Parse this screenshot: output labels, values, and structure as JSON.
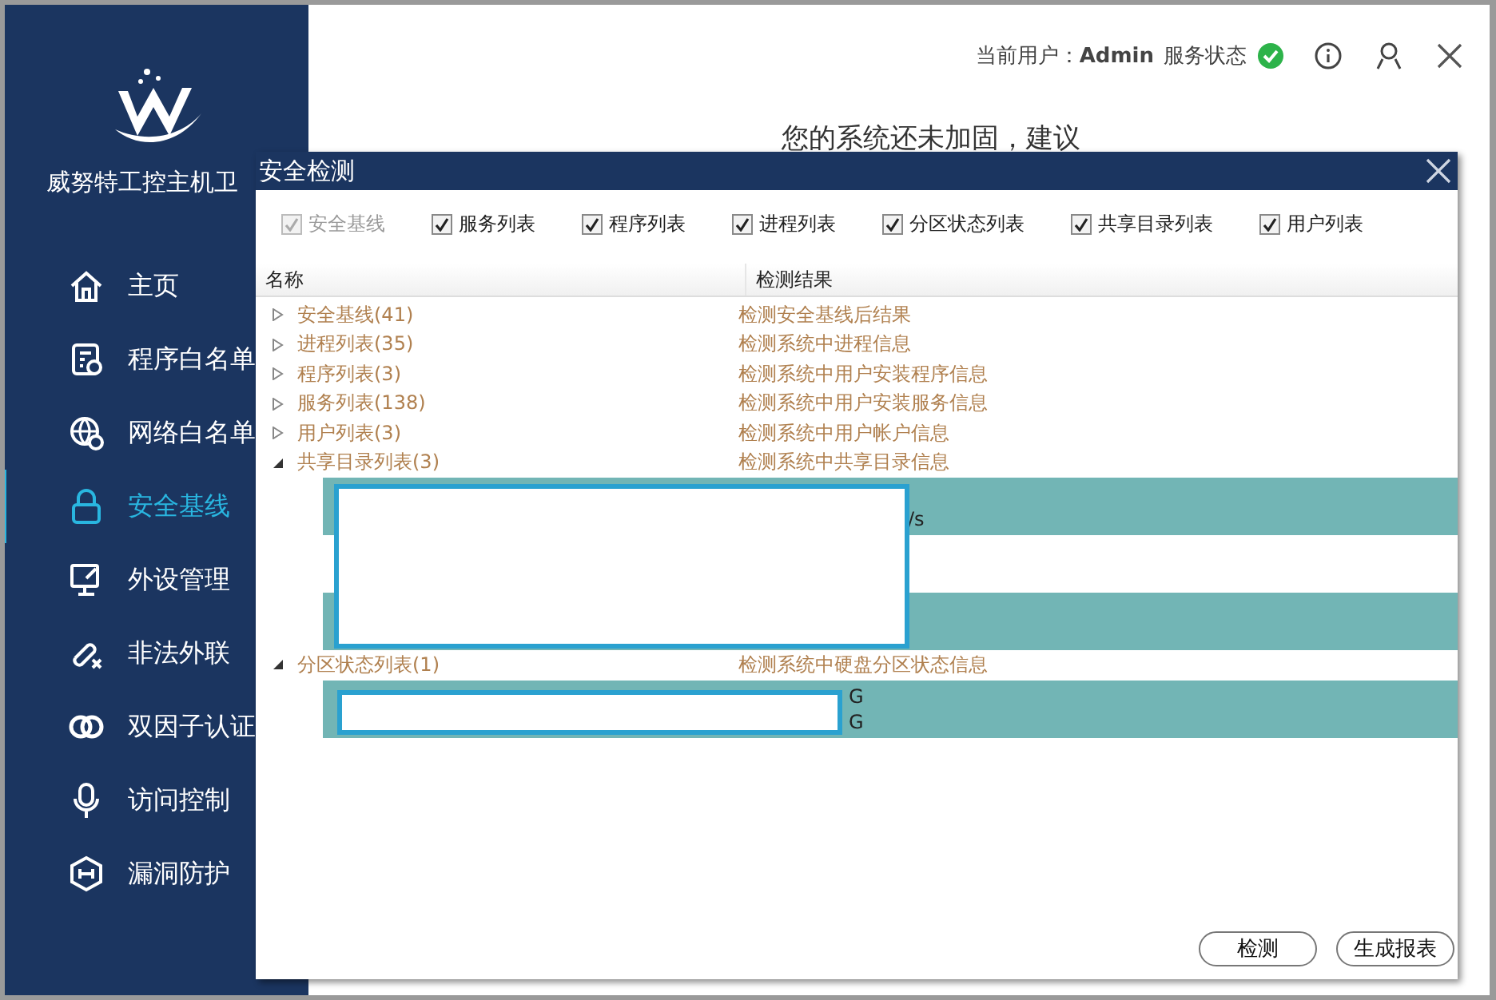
{
  "app": {
    "title": "威努特工控主机卫"
  },
  "sidebar": {
    "items": [
      {
        "label": "主页",
        "selected": false
      },
      {
        "label": "程序白名单",
        "selected": false
      },
      {
        "label": "网络白名单",
        "selected": false
      },
      {
        "label": "安全基线",
        "selected": true
      },
      {
        "label": "外设管理",
        "selected": false
      },
      {
        "label": "非法外联",
        "selected": false
      },
      {
        "label": "双因子认证",
        "selected": false
      },
      {
        "label": "访问控制",
        "selected": false
      },
      {
        "label": "漏洞防护",
        "selected": false
      }
    ]
  },
  "header": {
    "user_label": "当前用户：",
    "user": "Admin",
    "service_label": "服务状态",
    "service_ok": true
  },
  "main": {
    "notice": "您的系统还未加固，建议"
  },
  "dialog": {
    "title": "安全检测",
    "options": [
      {
        "label": "安全基线",
        "checked": true,
        "disabled": true
      },
      {
        "label": "服务列表",
        "checked": true,
        "disabled": false
      },
      {
        "label": "程序列表",
        "checked": true,
        "disabled": false
      },
      {
        "label": "进程列表",
        "checked": true,
        "disabled": false
      },
      {
        "label": "分区状态列表",
        "checked": true,
        "disabled": false
      },
      {
        "label": "共享目录列表",
        "checked": true,
        "disabled": false
      },
      {
        "label": "用户列表",
        "checked": true,
        "disabled": false
      }
    ],
    "columns": [
      "名称",
      "检测结果"
    ],
    "tree": [
      {
        "name": "安全基线(41)",
        "result": "检测安全基线后结果",
        "expanded": false
      },
      {
        "name": "进程列表(35)",
        "result": "检测系统中进程信息",
        "expanded": false
      },
      {
        "name": "程序列表(3)",
        "result": "检测系统中用户安装程序信息",
        "expanded": false
      },
      {
        "name": "服务列表(138)",
        "result": "检测系统中用户安装服务信息",
        "expanded": false
      },
      {
        "name": "用户列表(3)",
        "result": "检测系统中用户帐户信息",
        "expanded": false
      },
      {
        "name": "共享目录列表(3)",
        "result": "检测系统中共享目录信息",
        "expanded": true,
        "children": [
          {
            "kind": "shaded",
            "result_lines": [
              "/s"
            ]
          },
          {
            "kind": "plain"
          },
          {
            "kind": "shaded"
          }
        ]
      },
      {
        "name": "分区状态列表(1)",
        "result": "检测系统中硬盘分区状态信息",
        "expanded": true,
        "children": [
          {
            "kind": "shaded",
            "result_lines": [
              "G",
              "G"
            ]
          }
        ]
      }
    ],
    "buttons": [
      "检测",
      "生成报表"
    ]
  }
}
